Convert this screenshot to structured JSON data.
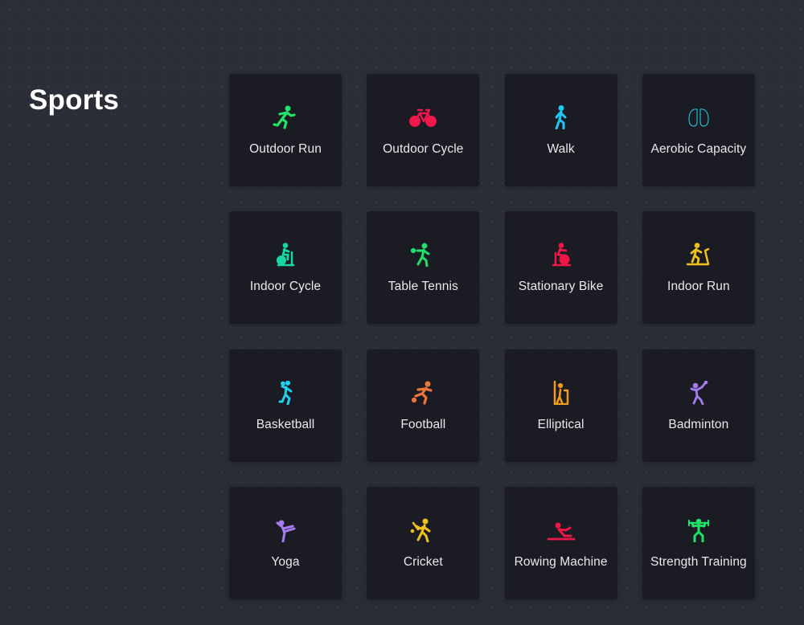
{
  "page": {
    "title": "Sports"
  },
  "sports": [
    {
      "label": "Outdoor Run",
      "icon": "running-person-icon",
      "color": "#22e36b"
    },
    {
      "label": "Outdoor Cycle",
      "icon": "bicycle-icon",
      "color": "#f0174a"
    },
    {
      "label": "Walk",
      "icon": "walking-person-icon",
      "color": "#1ec8f0"
    },
    {
      "label": "Aerobic Capacity",
      "icon": "lungs-icon",
      "color": "#1fd7f2"
    },
    {
      "label": "Indoor Cycle",
      "icon": "indoor-cycle-icon",
      "color": "#16d7a4"
    },
    {
      "label": "Table Tennis",
      "icon": "table-tennis-player-icon",
      "color": "#20e16a"
    },
    {
      "label": "Stationary Bike",
      "icon": "stationary-bike-icon",
      "color": "#ef1747"
    },
    {
      "label": "Indoor Run",
      "icon": "treadmill-icon",
      "color": "#f2c21b"
    },
    {
      "label": "Basketball",
      "icon": "basketball-player-icon",
      "color": "#1fd1ee"
    },
    {
      "label": "Football",
      "icon": "football-player-icon",
      "color": "#f0733a"
    },
    {
      "label": "Elliptical",
      "icon": "elliptical-machine-icon",
      "color": "#f29a1e"
    },
    {
      "label": "Badminton",
      "icon": "badminton-player-icon",
      "color": "#a77cf0"
    },
    {
      "label": "Yoga",
      "icon": "yoga-pose-icon",
      "color": "#a77cf0"
    },
    {
      "label": "Cricket",
      "icon": "cricket-player-icon",
      "color": "#f2c21b"
    },
    {
      "label": "Rowing Machine",
      "icon": "rowing-machine-icon",
      "color": "#ef1747"
    },
    {
      "label": "Strength Training",
      "icon": "weightlifting-icon",
      "color": "#20e16a"
    }
  ]
}
